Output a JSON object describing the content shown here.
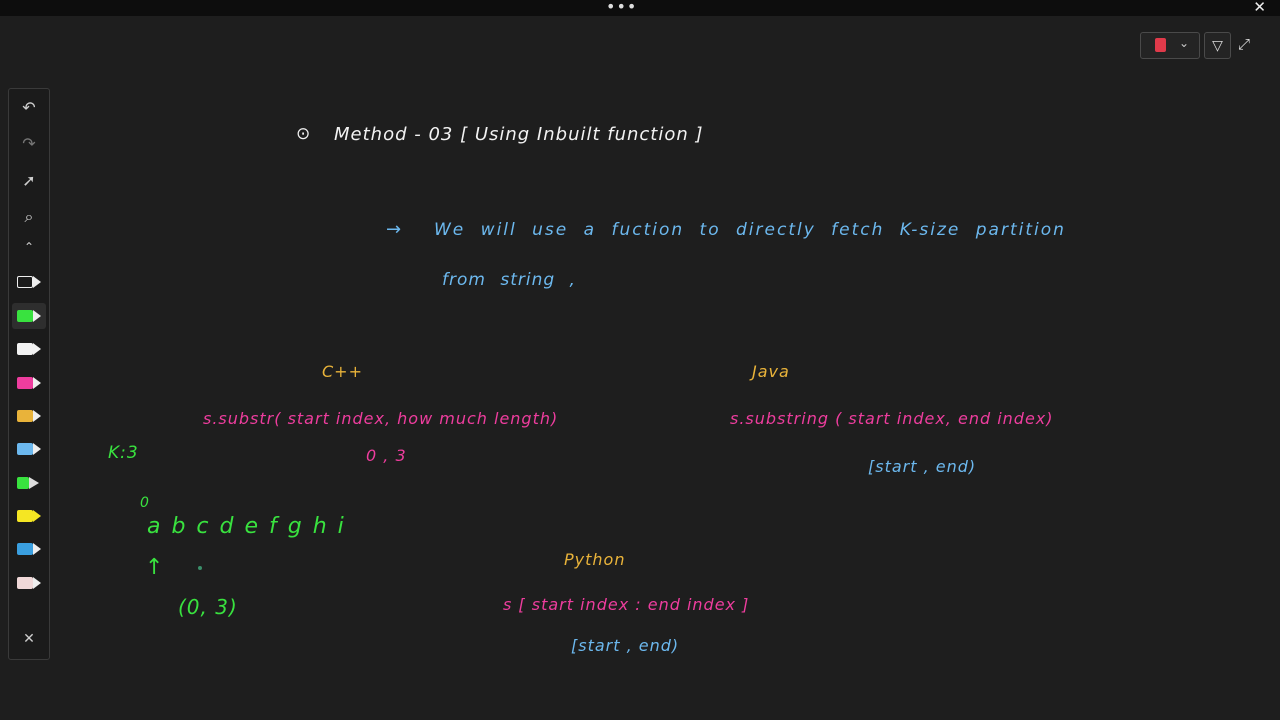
{
  "heading": {
    "bullet": "⊙",
    "text": "Method - 03   [ Using Inbuilt function ]"
  },
  "note": {
    "arrow": "→",
    "line1": "We will use a fuction to directly fetch K-size partition",
    "line2": "from string ,"
  },
  "cpp": {
    "title": "C++",
    "syntax": "s.substr( start index, how much length)",
    "args": "0  ,   3"
  },
  "java": {
    "title": "Java",
    "syntax": "s.substring ( start index, end index)",
    "range": "[start , end)"
  },
  "python": {
    "title": "Python",
    "syntax": "s [ start index : end index ]",
    "range": "[start , end)"
  },
  "example": {
    "k": "K:3",
    "zero": "0",
    "letters": "a b c  d e f g h i",
    "arrow": "↑",
    "range": "(0, 3)"
  },
  "colors": {
    "background": "#1e1e1e",
    "heading": "#f2f2f2",
    "note": "#6cb8ee",
    "titles": "#e9b33a",
    "syntax": "#ee3d9e",
    "example": "#39e23f"
  },
  "toolbar": {
    "tools": [
      "undo-icon",
      "redo-icon",
      "pointer-icon",
      "search-icon",
      "collapse-icon",
      "eye-pen-icon",
      "green-pen-icon",
      "white-pen-icon",
      "pink-pen-icon",
      "yellow-pen-icon",
      "blue-pen-icon",
      "green-marker-icon",
      "yellow-highlighter-icon",
      "blue-pen-2-icon",
      "light-pen-icon",
      "close-icon"
    ]
  },
  "window": {
    "menu_dots": "•••",
    "close": "✕"
  }
}
